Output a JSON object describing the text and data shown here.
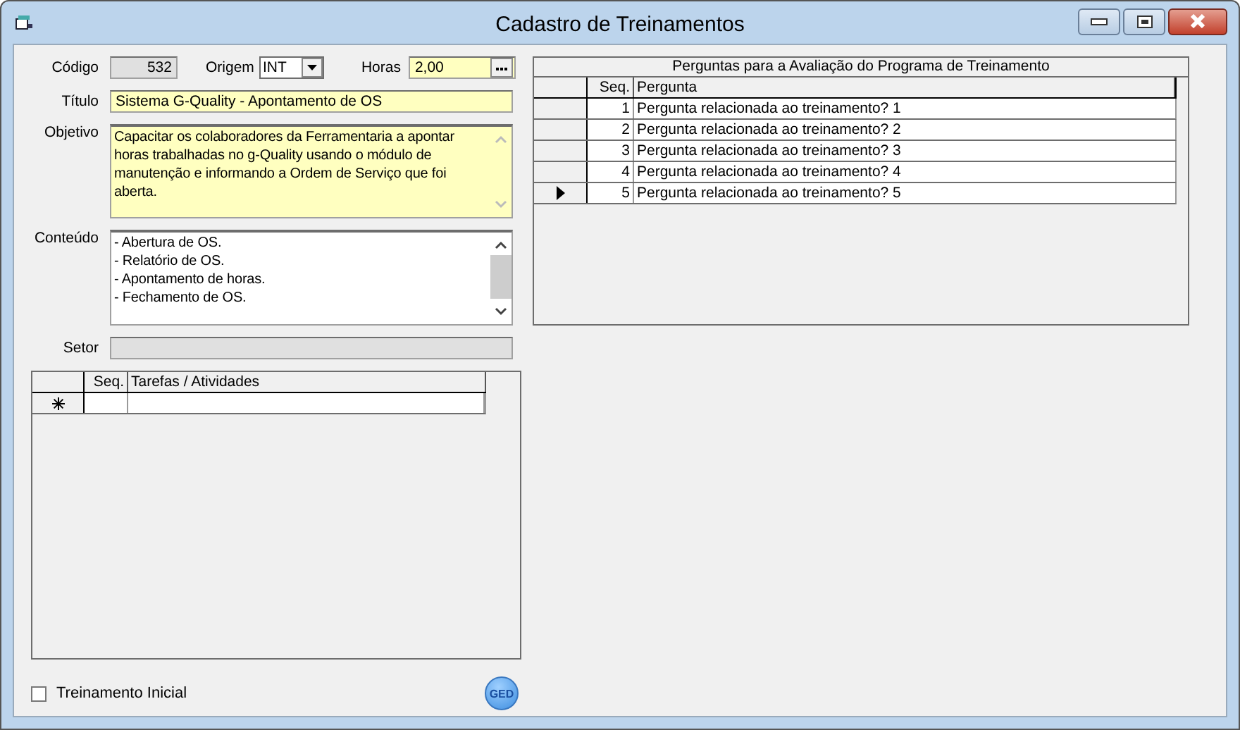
{
  "window": {
    "title": "Cadastro de Treinamentos"
  },
  "form": {
    "codigo": {
      "label": "Código",
      "value": "532"
    },
    "origem": {
      "label": "Origem",
      "value": "INT"
    },
    "horas": {
      "label": "Horas",
      "value": "2,00"
    },
    "titulo": {
      "label": "Título",
      "value": "Sistema G-Quality - Apontamento de OS"
    },
    "objetivo": {
      "label": "Objetivo",
      "value": "Capacitar os colaboradores da Ferramentaria a apontar horas trabalhadas no g-Quality usando o módulo de manutenção e informando a Ordem de Serviço que foi aberta."
    },
    "conteudo": {
      "label": "Conteúdo",
      "lines": [
        "- Abertura de OS.",
        "- Relatório de OS.",
        "- Apontamento de horas.",
        "- Fechamento de OS."
      ]
    },
    "setor": {
      "label": "Setor"
    }
  },
  "tasks": {
    "columns": [
      "Seq.",
      "Tarefas / Atividades"
    ]
  },
  "questions": {
    "caption": "Perguntas para a Avaliação do Programa de Treinamento",
    "columns": [
      "Seq.",
      "Pergunta"
    ],
    "rows": [
      {
        "seq": "1",
        "pergunta": "Pergunta relacionada ao treinamento? 1",
        "selected": false
      },
      {
        "seq": "2",
        "pergunta": "Pergunta relacionada ao treinamento? 2",
        "selected": false
      },
      {
        "seq": "3",
        "pergunta": "Pergunta relacionada ao treinamento? 3",
        "selected": false
      },
      {
        "seq": "4",
        "pergunta": "Pergunta relacionada ao treinamento? 4",
        "selected": false
      },
      {
        "seq": "5",
        "pergunta": "Pergunta relacionada ao treinamento? 5",
        "selected": true
      }
    ]
  },
  "initial": {
    "label": "Treinamento Inicial",
    "checked": false
  },
  "ged": {
    "label": "GED"
  }
}
